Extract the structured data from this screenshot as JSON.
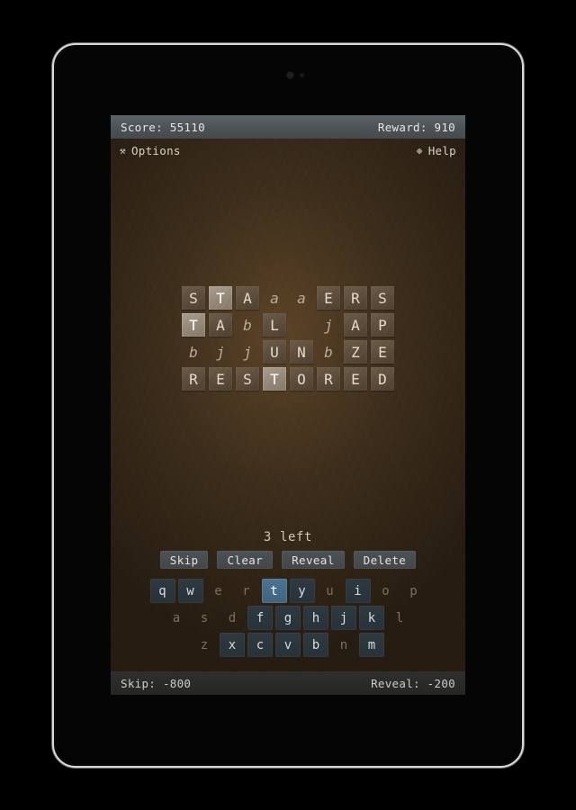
{
  "device": {
    "camera_icon": "camera-lens",
    "sensor_icon": "proximity-sensor"
  },
  "status_bar": {
    "score_label": "Score: 55110",
    "reward_label": "Reward: 910"
  },
  "menu_bar": {
    "options_glyph": "⚒",
    "options_label": "Options",
    "help_glyph": "❉",
    "help_label": "Help"
  },
  "grid": {
    "rows": [
      [
        {
          "ch": "S",
          "state": "tile"
        },
        {
          "ch": "T",
          "state": "tile-hl"
        },
        {
          "ch": "A",
          "state": "tile"
        },
        {
          "ch": "a",
          "state": "hint"
        },
        {
          "ch": "a",
          "state": "hint"
        },
        {
          "ch": "E",
          "state": "tile"
        },
        {
          "ch": "R",
          "state": "tile"
        },
        {
          "ch": "S",
          "state": "tile"
        }
      ],
      [
        {
          "ch": "T",
          "state": "tile-hl"
        },
        {
          "ch": "A",
          "state": "tile"
        },
        {
          "ch": "b",
          "state": "hint"
        },
        {
          "ch": "L",
          "state": "tile"
        },
        {
          "ch": "",
          "state": "blank"
        },
        {
          "ch": "j",
          "state": "hint"
        },
        {
          "ch": "A",
          "state": "tile"
        },
        {
          "ch": "P",
          "state": "tile"
        }
      ],
      [
        {
          "ch": "b",
          "state": "hint"
        },
        {
          "ch": "j",
          "state": "hint"
        },
        {
          "ch": "j",
          "state": "hint"
        },
        {
          "ch": "U",
          "state": "tile"
        },
        {
          "ch": "N",
          "state": "tile"
        },
        {
          "ch": "b",
          "state": "hint"
        },
        {
          "ch": "Z",
          "state": "tile"
        },
        {
          "ch": "E",
          "state": "tile"
        }
      ],
      [
        {
          "ch": "R",
          "state": "tile"
        },
        {
          "ch": "E",
          "state": "tile"
        },
        {
          "ch": "S",
          "state": "tile"
        },
        {
          "ch": "T",
          "state": "tile-hl"
        },
        {
          "ch": "O",
          "state": "tile"
        },
        {
          "ch": "R",
          "state": "tile"
        },
        {
          "ch": "E",
          "state": "tile"
        },
        {
          "ch": "D",
          "state": "tile"
        }
      ]
    ]
  },
  "counter": {
    "left_label": "3 left"
  },
  "actions": [
    {
      "label": "Skip",
      "name": "skip-button"
    },
    {
      "label": "Clear",
      "name": "clear-button"
    },
    {
      "label": "Reveal",
      "name": "reveal-button"
    },
    {
      "label": "Delete",
      "name": "delete-button"
    }
  ],
  "keyboard": {
    "rows": [
      [
        {
          "k": "q",
          "state": "avail"
        },
        {
          "k": "w",
          "state": "avail"
        },
        {
          "k": "e",
          "state": "used"
        },
        {
          "k": "r",
          "state": "used"
        },
        {
          "k": "t",
          "state": "sel"
        },
        {
          "k": "y",
          "state": "avail"
        },
        {
          "k": "u",
          "state": "used"
        },
        {
          "k": "i",
          "state": "avail"
        },
        {
          "k": "o",
          "state": "used"
        },
        {
          "k": "p",
          "state": "used"
        }
      ],
      [
        {
          "k": "a",
          "state": "used"
        },
        {
          "k": "s",
          "state": "used"
        },
        {
          "k": "d",
          "state": "used"
        },
        {
          "k": "f",
          "state": "avail"
        },
        {
          "k": "g",
          "state": "avail"
        },
        {
          "k": "h",
          "state": "avail"
        },
        {
          "k": "j",
          "state": "avail"
        },
        {
          "k": "k",
          "state": "avail"
        },
        {
          "k": "l",
          "state": "used"
        }
      ],
      [
        {
          "k": "z",
          "state": "used"
        },
        {
          "k": "x",
          "state": "avail"
        },
        {
          "k": "c",
          "state": "avail"
        },
        {
          "k": "v",
          "state": "avail"
        },
        {
          "k": "b",
          "state": "avail"
        },
        {
          "k": "n",
          "state": "used"
        },
        {
          "k": "m",
          "state": "avail"
        }
      ]
    ]
  },
  "bottom_bar": {
    "skip_cost_label": "Skip: -800",
    "reveal_cost_label": "Reveal: -200"
  },
  "colors": {
    "screen_bg": "#3b2d1c",
    "status_bar_bg": "#4b5155",
    "bottom_bar_bg": "#2f2f2d",
    "tile_bg": "#5a4b3a",
    "tile_highlight_bg": "#938778",
    "key_avail_bg": "#27323a",
    "key_selected_bg": "#3f647e",
    "action_btn_bg": "#41474a",
    "text_primary": "#e8e6e0",
    "hint_text": "#b9ad9e",
    "key_used_text": "#7d6f5d"
  }
}
